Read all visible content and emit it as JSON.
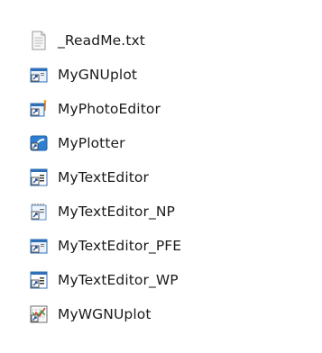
{
  "files": [
    {
      "name": "_ReadMe.txt",
      "icon": "text-document-icon"
    },
    {
      "name": "MyGNUplot",
      "icon": "shortcut-app-icon"
    },
    {
      "name": "MyPhotoEditor",
      "icon": "photo-editor-shortcut-icon"
    },
    {
      "name": "MyPlotter",
      "icon": "plotter-shortcut-icon"
    },
    {
      "name": "MyTextEditor",
      "icon": "text-editor-shortcut-icon"
    },
    {
      "name": "MyTextEditor_NP",
      "icon": "notepad-shortcut-icon"
    },
    {
      "name": "MyTextEditor_PFE",
      "icon": "shortcut-app-icon"
    },
    {
      "name": "MyTextEditor_WP",
      "icon": "text-editor-shortcut-icon"
    },
    {
      "name": "MyWGNUplot",
      "icon": "chart-shortcut-icon"
    }
  ],
  "colors": {
    "shortcut_arrow": "#1f4e9e",
    "window_frame": "#2f6fb7",
    "selection": "#ffffff"
  }
}
